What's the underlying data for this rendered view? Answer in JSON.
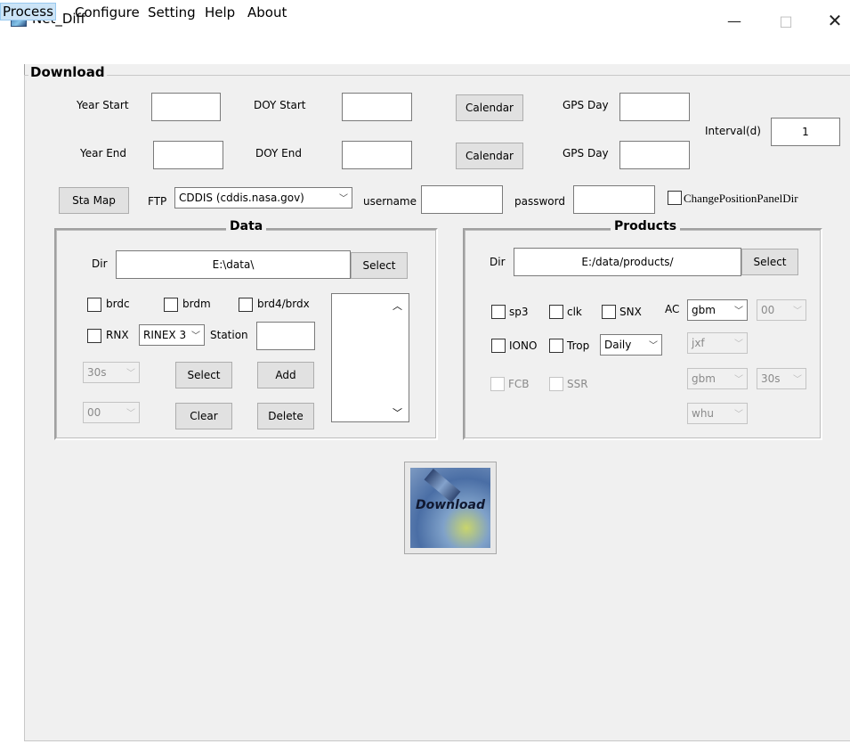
{
  "window": {
    "title": "Net_Diff",
    "minimize": "—",
    "maximize": "□",
    "close": "✕"
  },
  "menu": [
    "Process",
    "Configure",
    "Setting",
    "Help",
    "About"
  ],
  "panel_title": "Download",
  "dates": {
    "year_start_label": "Year Start",
    "doy_start_label": "DOY Start",
    "year_end_label": "Year End",
    "doy_end_label": "DOY End",
    "calendar_label": "Calendar",
    "gps_day_label": "GPS Day",
    "interval_label": "Interval(d)",
    "interval_value": "1"
  },
  "connection": {
    "sta_map_label": "Sta Map",
    "ftp_label": "FTP",
    "ftp_value": "CDDIS (cddis.nasa.gov)",
    "username_label": "username",
    "password_label": "password",
    "change_position_label": "ChangePositionPanelDir"
  },
  "data_group": {
    "title": "Data",
    "dir_label": "Dir",
    "dir_value": "E:\\data\\",
    "select_label": "Select",
    "brdc": "brdc",
    "brdm": "brdm",
    "brd4": "brd4/brdx",
    "rnx": "RNX",
    "rinex_value": "RINEX 3",
    "station_label": "Station",
    "interval_value": "30s",
    "hour_value": "00",
    "select_btn": "Select",
    "add_btn": "Add",
    "clear_btn": "Clear",
    "delete_btn": "Delete"
  },
  "products_group": {
    "title": "Products",
    "dir_label": "Dir",
    "dir_value": "E:/data/products/",
    "select_label": "Select",
    "sp3": "sp3",
    "clk": "clk",
    "snx": "SNX",
    "ac_label": "AC",
    "ac_value": "gbm",
    "ac_hour": "00",
    "iono": "IONO",
    "trop": "Trop",
    "trop_freq": "Daily",
    "iono_ac": "jxf",
    "fcb": "FCB",
    "ssr": "SSR",
    "fcb_ac": "gbm",
    "fcb_interval": "30s",
    "ssr_ac": "whu"
  },
  "download_label": "Download"
}
